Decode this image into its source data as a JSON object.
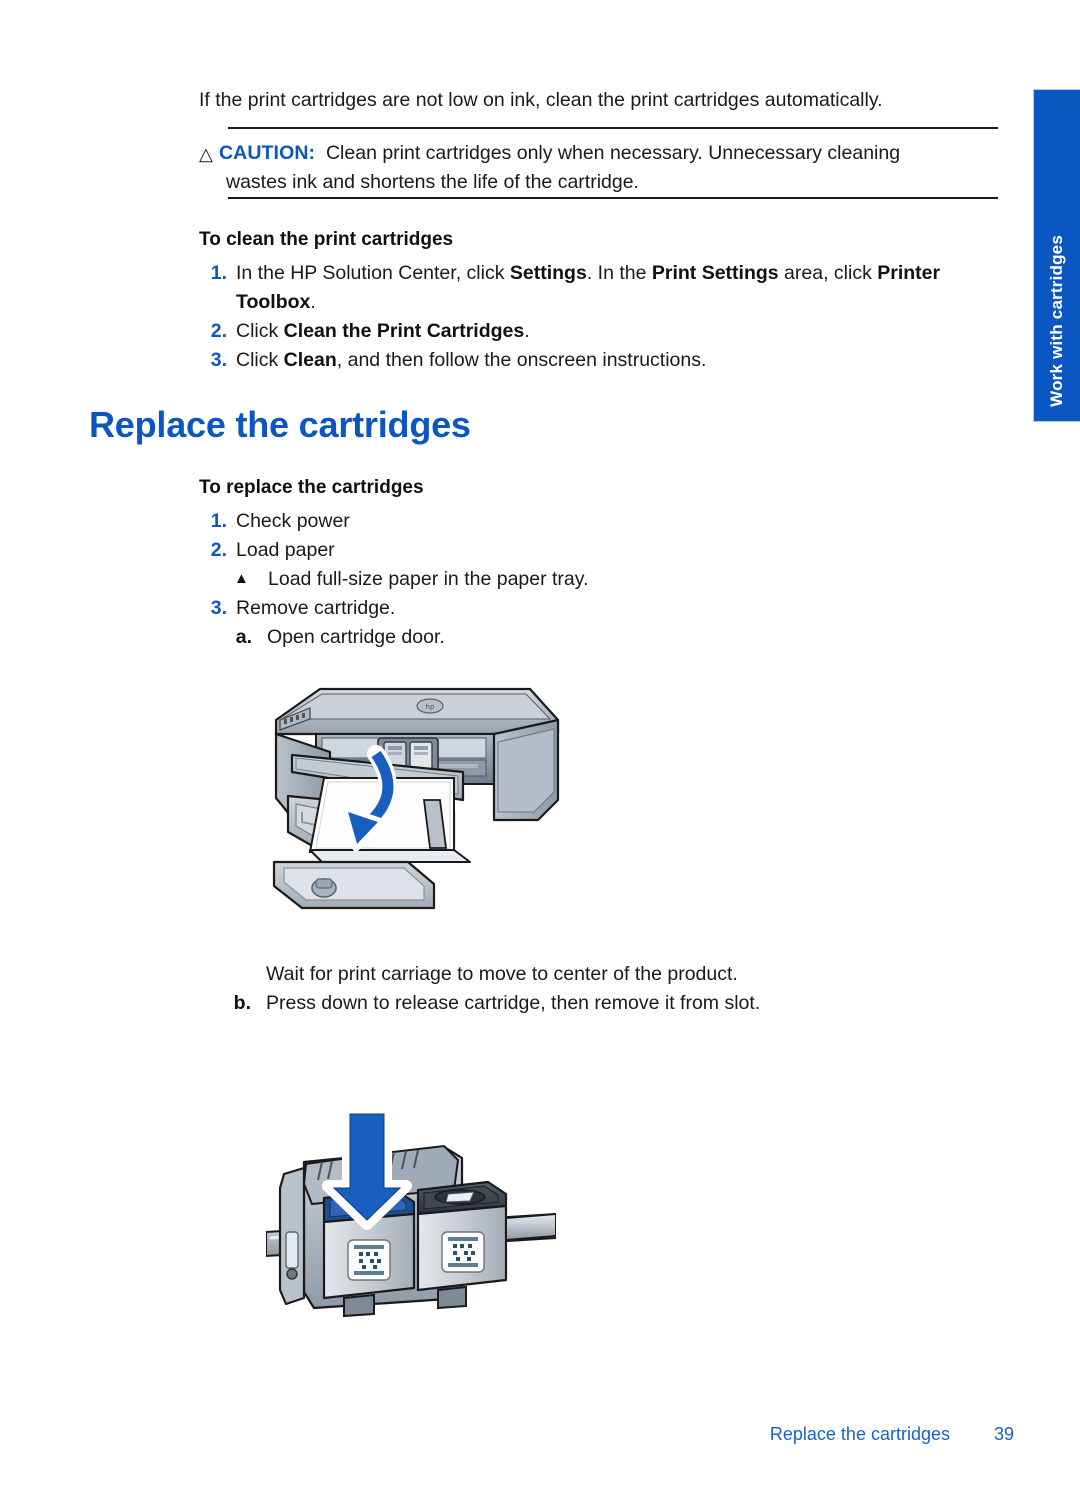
{
  "side_tab": {
    "label": "Work with cartridges",
    "color": "#0B57C2"
  },
  "intro": {
    "text": "If the print cartridges are not low on ink, clean the print cartridges automatically."
  },
  "caution": {
    "icon": "warning-triangle-icon",
    "label": "CAUTION:",
    "line1": "Clean print cartridges only when necessary. Unnecessary cleaning",
    "line2": "wastes ink and shortens the life of the cartridge.",
    "color": "#0B57C2"
  },
  "clean_section": {
    "heading": "To clean the print cartridges",
    "steps": [
      {
        "num": "1.",
        "parts": [
          {
            "t": "In the HP Solution Center, click ",
            "b": false
          },
          {
            "t": "Settings",
            "b": true
          },
          {
            "t": ". In the ",
            "b": false
          },
          {
            "t": "Print Settings",
            "b": true
          },
          {
            "t": " area, click ",
            "b": false
          },
          {
            "t": "Printer Toolbox",
            "b": true
          },
          {
            "t": ".",
            "b": false
          }
        ]
      },
      {
        "num": "2.",
        "parts": [
          {
            "t": "Click ",
            "b": false
          },
          {
            "t": "Clean the Print Cartridges",
            "b": true
          },
          {
            "t": ".",
            "b": false
          }
        ]
      },
      {
        "num": "3.",
        "parts": [
          {
            "t": "Click ",
            "b": false
          },
          {
            "t": "Clean",
            "b": true
          },
          {
            "t": ", and then follow the onscreen instructions.",
            "b": false
          }
        ]
      }
    ]
  },
  "main_heading": {
    "text": "Replace the cartridges",
    "color": "#0B57C2"
  },
  "replace_section": {
    "heading": "To replace the cartridges",
    "step1": {
      "num": "1.",
      "text": "Check power"
    },
    "step2": {
      "num": "2.",
      "text": "Load paper"
    },
    "step2_bullet": {
      "marker": "▲",
      "text": "Load full-size paper in the paper tray."
    },
    "step3": {
      "num": "3.",
      "text": "Remove cartridge."
    },
    "step3a": {
      "letter": "a.",
      "text": "Open cartridge door."
    },
    "wait_note": "Wait for print carriage to move to center of the product.",
    "step3b": {
      "letter": "b.",
      "text": "Press down to release cartridge, then remove it from slot."
    }
  },
  "figures": {
    "printer": {
      "name": "hp-all-in-one-printer-open-door-illustration",
      "arrow": "curved-down-arrow",
      "arrow_color": "#1A5FBF"
    },
    "cartridge": {
      "name": "ink-cartridge-carriage-illustration",
      "arrow": "down-arrow",
      "arrow_color": "#1A5FBF"
    }
  },
  "footer": {
    "title": "Replace the cartridges",
    "page": "39",
    "color": "#1763C6"
  }
}
